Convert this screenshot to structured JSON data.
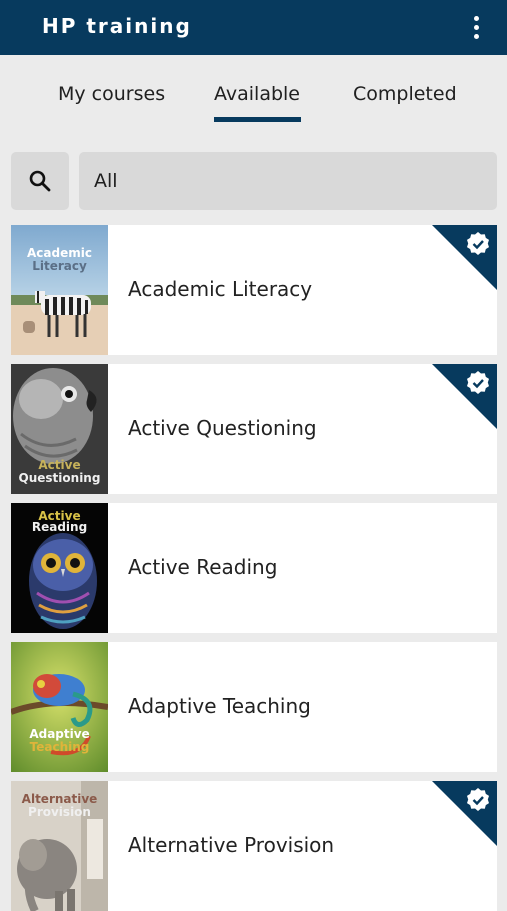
{
  "app": {
    "title": "HP training"
  },
  "icons": {
    "menu": "more-vert-icon",
    "search": "search-icon",
    "completed": "check-badge-icon"
  },
  "colors": {
    "primary": "#073a5e",
    "background": "#ebebeb",
    "field": "#d9d9d9"
  },
  "tabs": [
    {
      "label": "My courses",
      "active": false
    },
    {
      "label": "Available",
      "active": true
    },
    {
      "label": "Completed",
      "active": false
    }
  ],
  "filter": {
    "value": "All"
  },
  "courses": [
    {
      "title": "Academic Literacy",
      "thumb_text_1": "Academic",
      "thumb_text_2": "Literacy",
      "completed": true
    },
    {
      "title": "Active Questioning",
      "thumb_text_1": "Active",
      "thumb_text_2": "Questioning",
      "completed": true
    },
    {
      "title": "Active Reading",
      "thumb_text_1": "Active",
      "thumb_text_2": "Reading",
      "completed": false
    },
    {
      "title": "Adaptive Teaching",
      "thumb_text_1": "Adaptive",
      "thumb_text_2": "Teaching",
      "completed": false
    },
    {
      "title": "Alternative Provision",
      "thumb_text_1": "Alternative",
      "thumb_text_2": "Provision",
      "completed": true
    }
  ]
}
